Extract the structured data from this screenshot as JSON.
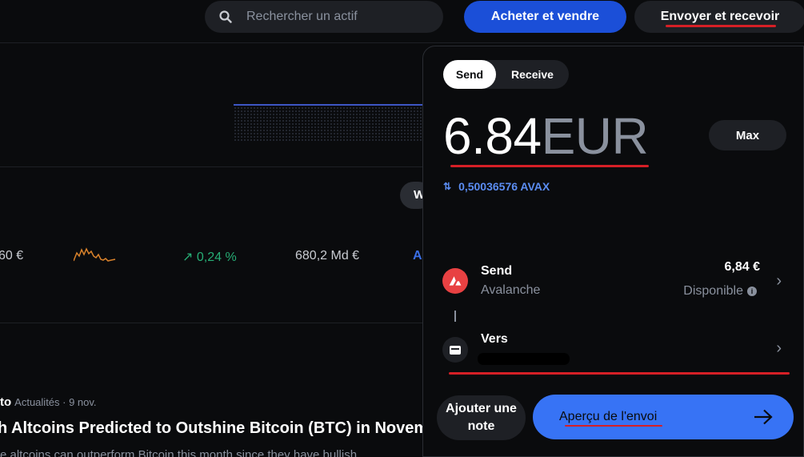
{
  "header": {
    "search_placeholder": "Rechercher un actif",
    "buy_sell_label": "Acheter et vendre",
    "send_receive_label": "Envoyer et recevoir"
  },
  "background": {
    "chart_pill": "W",
    "row": {
      "price_partial": "60 €",
      "change": "↗ 0,24 %",
      "market_cap": "680,2 Md €",
      "action_partial": "A"
    },
    "news": {
      "source_partial": "to",
      "meta": "Actualités · 9 nov.",
      "title_partial": "h Altcoins Predicted to Outshine Bitcoin (BTC) in Novem",
      "body_partial": "e altcoins can outperform Bitcoin this month since they have bullish"
    }
  },
  "panel": {
    "tabs": [
      {
        "label": "Send",
        "active": true
      },
      {
        "label": "Receive",
        "active": false
      }
    ],
    "amount": "6.84",
    "currency": "EUR",
    "max_label": "Max",
    "conversion": "0,50036576 AVAX",
    "from": {
      "title": "Send",
      "network": "Avalanche",
      "balance": "6,84 €",
      "balance_label": "Disponible"
    },
    "to": {
      "title": "Vers"
    },
    "add_note_label": "Ajouter une note",
    "preview_label": "Aperçu de l'envoi"
  },
  "colors": {
    "accent_blue": "#3773f5",
    "buy_blue": "#1b4fd8",
    "avalanche_red": "#e84142",
    "annotation_red": "#d61f26",
    "positive_green": "#27ad75"
  },
  "icons": [
    "search-icon",
    "swap-icon",
    "avalanche-icon",
    "info-icon",
    "chevron-right-icon",
    "wallet-icon",
    "arrow-right-icon"
  ]
}
